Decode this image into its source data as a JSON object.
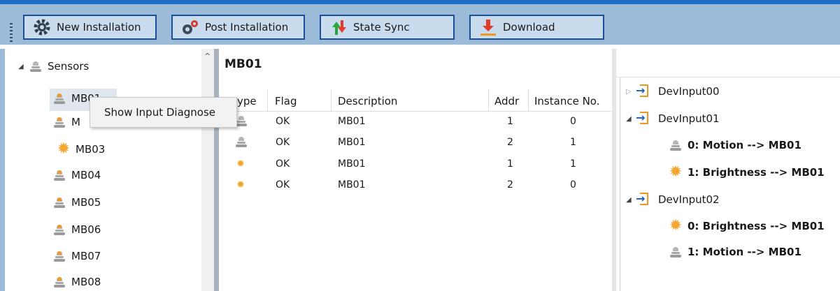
{
  "toolbar": {
    "new_installation": "New Installation",
    "post_installation": "Post Installation",
    "state_sync": "State Sync",
    "download": "Download"
  },
  "sensors_tree": {
    "root_label": "Sensors",
    "items": [
      {
        "label": "MB01",
        "icon": "motion-sensor-icon"
      },
      {
        "label": "MB02",
        "icon": "motion-sensor-icon"
      },
      {
        "label": "MB03",
        "icon": "brightness-sun-icon"
      },
      {
        "label": "MB04",
        "icon": "motion-sensor-icon"
      },
      {
        "label": "MB05",
        "icon": "motion-sensor-icon"
      },
      {
        "label": "MB06",
        "icon": "motion-sensor-icon"
      },
      {
        "label": "MB07",
        "icon": "motion-sensor-icon"
      },
      {
        "label": "MB08",
        "icon": "motion-sensor-icon"
      }
    ],
    "visible_labels": [
      "M",
      "MB03",
      "MB04",
      "MB05",
      "MB06",
      "MB07",
      "MB08"
    ],
    "partial_first": "MB01"
  },
  "context_menu": {
    "item": "Show Input Diagnose"
  },
  "detail": {
    "title": "MB01",
    "columns": [
      "ype",
      "Flag",
      "Description",
      "Addr",
      "Instance No."
    ],
    "rows": [
      {
        "type_icon": "motion-sensor-icon",
        "flag": "OK",
        "description": "MB01",
        "addr": "1",
        "instance": "0"
      },
      {
        "type_icon": "motion-sensor-icon",
        "flag": "OK",
        "description": "MB01",
        "addr": "2",
        "instance": "1"
      },
      {
        "type_icon": "brightness-sun-icon",
        "flag": "OK",
        "description": "MB01",
        "addr": "1",
        "instance": "1"
      },
      {
        "type_icon": "brightness-sun-icon",
        "flag": "OK",
        "description": "MB01",
        "addr": "2",
        "instance": "0"
      }
    ]
  },
  "inputs_tree": {
    "devices": [
      {
        "label": "DevInput00",
        "expanded": false,
        "children": []
      },
      {
        "label": "DevInput01",
        "expanded": true,
        "children": [
          {
            "icon": "motion-sensor-icon",
            "label": "0: Motion --> MB01"
          },
          {
            "icon": "brightness-sun-icon",
            "label": "1: Brightness --> MB01"
          }
        ]
      },
      {
        "label": "DevInput02",
        "expanded": true,
        "children": [
          {
            "icon": "brightness-sun-icon",
            "label": "0: Brightness --> MB01"
          },
          {
            "icon": "motion-sensor-icon",
            "label": "1: Motion --> MB01"
          }
        ]
      }
    ]
  },
  "colors": {
    "toolbar_bg": "#9bbbd9",
    "button_border": "#1b4f9c",
    "button_bg": "#c9dcee",
    "accent_orange": "#f0961e",
    "top_stripe": "#1e6fc6"
  }
}
